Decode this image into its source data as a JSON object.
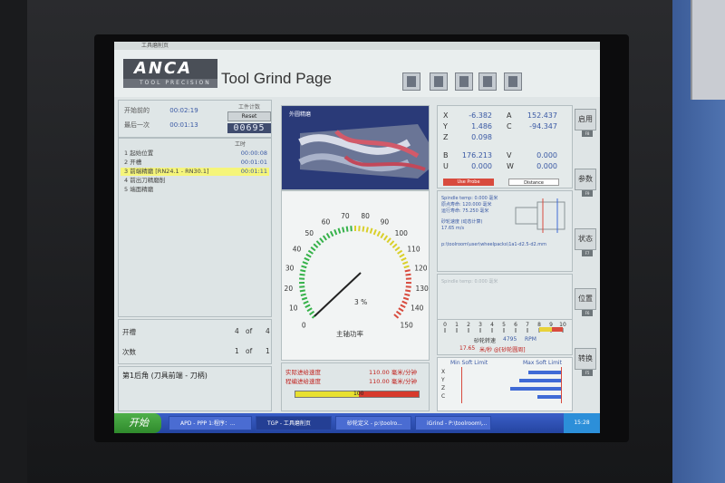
{
  "window": {
    "title": "工具磨削页"
  },
  "header": {
    "logo": "ANCA",
    "logo_sub": "TOOL PRECISION",
    "title": "Tool Grind Page"
  },
  "timers": [
    {
      "label": "开始前的",
      "value": "00:02:19"
    },
    {
      "label": "最后一次",
      "value": "00:01:13"
    }
  ],
  "counter": {
    "label": "工件计数",
    "reset": "Reset",
    "value": "00695"
  },
  "ops": {
    "header": "工时",
    "rows": [
      {
        "label": "1 起始位置",
        "time": "00:00:08"
      },
      {
        "label": "2 开槽",
        "time": "00:01:01"
      },
      {
        "label": "3 前端精磨 [RN24.1 - RN30.1]",
        "time": "00:01:11",
        "selected": true
      },
      {
        "label": "4 前出刀精磨削",
        "time": ""
      },
      {
        "label": "5 端面精磨",
        "time": ""
      }
    ]
  },
  "counts": [
    {
      "label": "开槽",
      "n": "4",
      "of": "of",
      "m": "4"
    },
    {
      "label": "次数",
      "n": "1",
      "of": "of",
      "m": "1"
    }
  ],
  "operation_name": "第1后角 (刀具前端 - 刀柄)",
  "tool_image": {
    "label": "外圆精磨"
  },
  "gauge": {
    "label": "主轴功率",
    "percent": "3",
    "unit": "%",
    "ticks": [
      "0",
      "10",
      "20",
      "30",
      "40",
      "50",
      "60",
      "70",
      "80",
      "90",
      "100",
      "110",
      "120",
      "130",
      "140",
      "150"
    ],
    "value": 3
  },
  "feed": {
    "rows": [
      {
        "label": "实际进给速度",
        "value": "110.00 毫米/分钟"
      },
      {
        "label": "程编进给速度",
        "value": "110.00 毫米/分钟"
      }
    ],
    "bar_value": "100"
  },
  "axes": [
    {
      "name": "X",
      "value": "-6.382"
    },
    {
      "name": "Y",
      "value": "1.486"
    },
    {
      "name": "Z",
      "value": "0.098"
    },
    {
      "name": "A",
      "value": "152.437"
    },
    {
      "name": "C",
      "value": "-94.347"
    },
    {
      "name": "B",
      "value": "176.213"
    },
    {
      "name": "U",
      "value": "0.000"
    },
    {
      "name": "V",
      "value": "0.000"
    },
    {
      "name": "W",
      "value": "0.000"
    }
  ],
  "axes_buttons": [
    "Use Probe",
    "Distance"
  ],
  "spindle": {
    "lines": [
      "Spindle temp: 0.000 毫米",
      "原点寿命: 120.000 毫米",
      "运行寿命: 75.250 毫米",
      "砂轮速度 (动态计算)",
      "17.65 m/s",
      "p:\\toolroom\\user\\wheelpacks\\1a1-d2.5-d2.mm"
    ]
  },
  "spindle_ghost": "Spindle temp: 0.000 毫米",
  "scale": {
    "ticks": [
      "0",
      "1",
      "2",
      "3",
      "4",
      "5",
      "6",
      "7",
      "8",
      "9",
      "10"
    ],
    "wheel_speed_label": "砂轮转速",
    "rpm_value": "4795",
    "rpm_unit": "RPM",
    "surface_speed": "17.65",
    "surface_unit": "米/秒 @[砂轮圆周]"
  },
  "soft_limit": {
    "min_label": "Min Soft Limit",
    "max_label": "Max Soft Limit",
    "axes": [
      "X",
      "Y",
      "Z",
      "C"
    ]
  },
  "side_buttons": [
    "启用",
    "参数",
    "状态",
    "位置",
    "转换"
  ],
  "fkeys": [
    "F8",
    "F9",
    "F7",
    "F6",
    "F5"
  ],
  "taskbar": {
    "start": "开始",
    "tasks": [
      "APD - PPP 1:程序：...",
      "TGP - 工具磨削页",
      "砂轮定义 - p:\\toolro...",
      "iGrind - P:\\toolroom\\..."
    ],
    "clock": "15:28"
  },
  "colors": {
    "accent_blue": "#3a59a4",
    "warning_red": "#c0221e",
    "highlight_yellow": "#f5f57a"
  }
}
